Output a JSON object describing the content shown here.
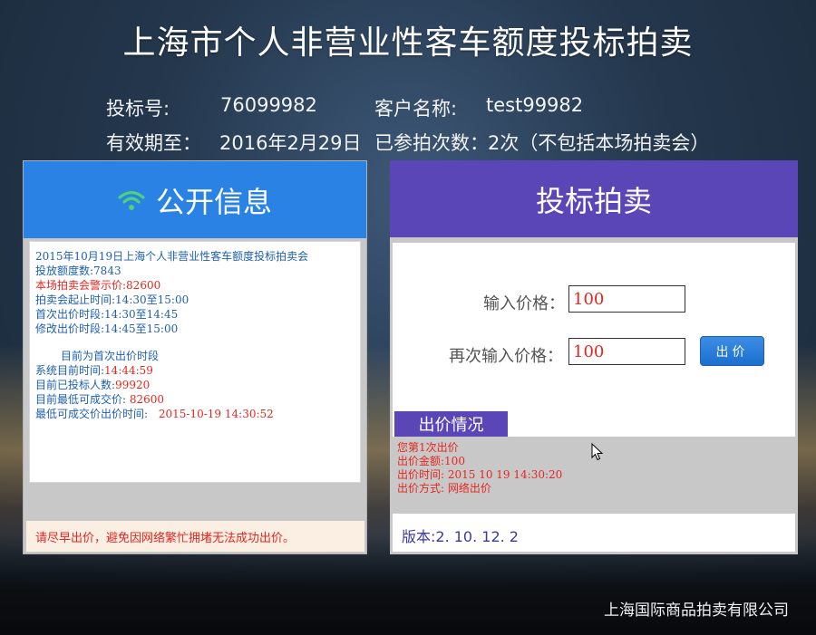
{
  "page": {
    "title": "上海市个人非营业性客车额度投标拍卖",
    "company": "上海国际商品拍卖有限公司"
  },
  "bidder": {
    "bid_no_label": "投标号:",
    "bid_no": "76099982",
    "client_label": "客户名称:",
    "client_name": "test99982",
    "valid_label": "有效期至：",
    "valid_date": "2016年2月29日",
    "count_label": "已参拍次数：",
    "count_value": "2次（不包括本场拍卖会）"
  },
  "public_info": {
    "header": "公开信息",
    "header_icon": "wifi-icon",
    "lines": {
      "auction_name": "2015年10月19日上海个人非营业性客车额度投标拍卖会",
      "quota": "投放额度数:7843",
      "warning_price": "本场拍卖会警示价:82600",
      "time_range": "拍卖会起止时间:14:30至15:00",
      "first_period": "首次出价时段:14:30至14:45",
      "modify_period": "修改出价时段:14:45至15:00",
      "current_phase": "目前为首次出价时段",
      "system_time_label": "系统目前时间:",
      "system_time": "14:44:59",
      "bidder_count_label": "目前已投标人数:",
      "bidder_count": "99920",
      "lowest_price_label": "目前最低可成交价:",
      "lowest_price": "82600",
      "lowest_time_label": "最低可成交价出价时间:",
      "lowest_time": "2015-10-19 14:30:52"
    },
    "footer_notice": "请尽早出价，避免因网络繁忙拥堵无法成功出价。"
  },
  "bidding": {
    "header": "投标拍卖",
    "price_label": "输入价格：",
    "price_value": "100",
    "confirm_label": "再次输入价格：",
    "confirm_value": "100",
    "submit_label": "出价",
    "status_tab": "出价情况",
    "status_lines": {
      "bid_index": "您第1次出价",
      "amount": "出价金额:100",
      "time": "出价时间: 2015 10 19 14:30:20",
      "method": "出价方式: 网络出价"
    },
    "version": "版本:2. 10. 12. 2"
  },
  "colors": {
    "left_header": "#2a82e4",
    "right_header": "#5b46b8",
    "wifi_icon": "#4fd07a",
    "info_blue": "#1e5fb0",
    "alert_red": "#e8261e"
  }
}
